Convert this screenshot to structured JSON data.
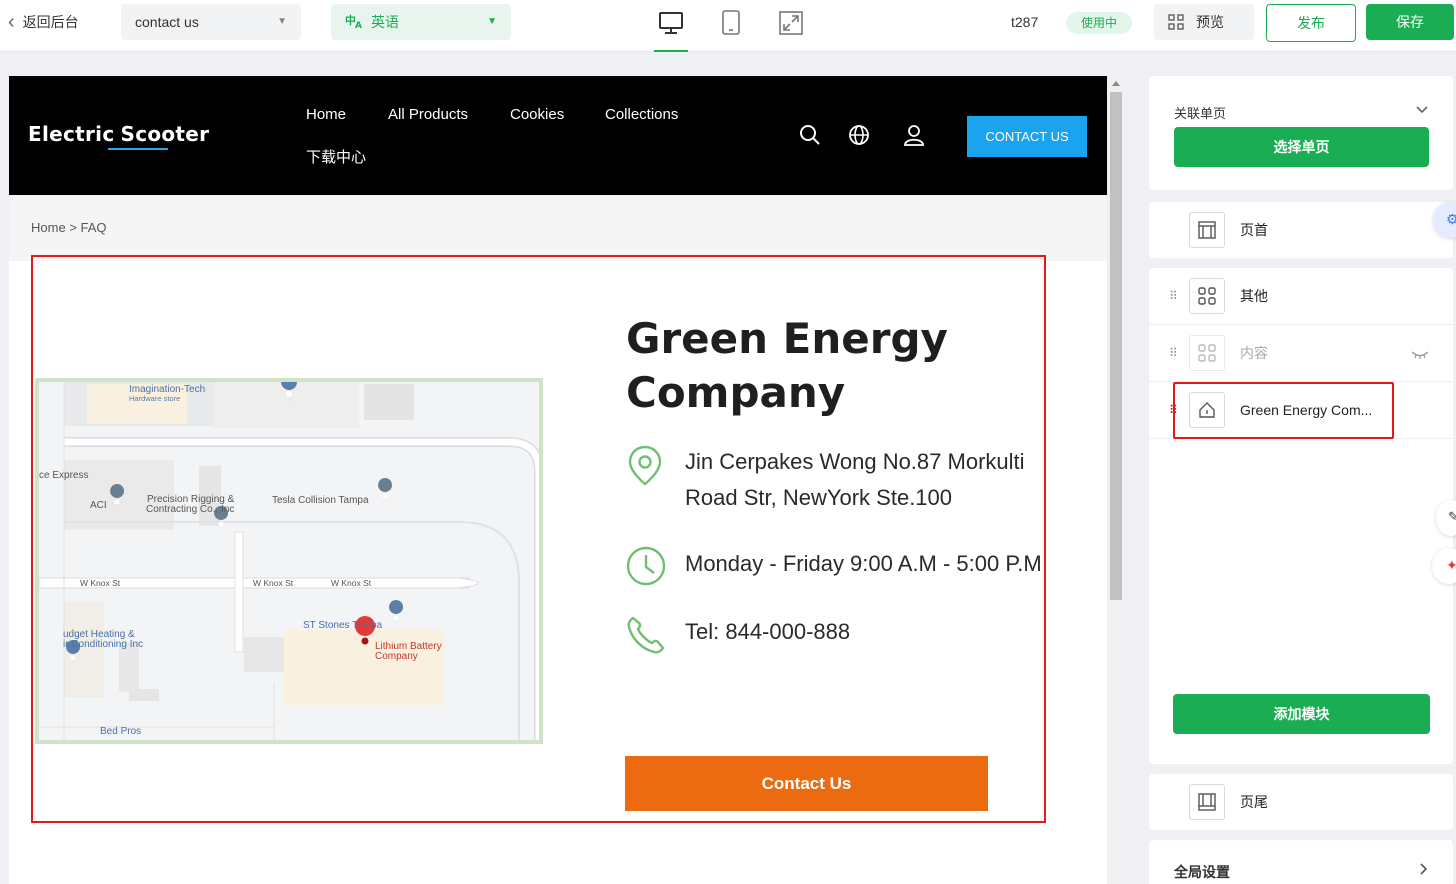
{
  "toolbar": {
    "back_label": "返回后台",
    "page_select": "contact us",
    "lang_select": "英语",
    "theme_id": "t287",
    "status_badge": "使用中",
    "preview_label": "预览",
    "publish_label": "发布",
    "save_label": "保存",
    "active_device": "desktop"
  },
  "site": {
    "logo_part1": "Electric",
    "logo_part2": "Scooter",
    "nav": [
      "Home",
      "All Products",
      "Cookies",
      "Collections",
      "下载中心"
    ],
    "header_button": "CONTACT US",
    "breadcrumb_home": "Home",
    "breadcrumb_sep": ">",
    "breadcrumb_current": "FAQ"
  },
  "content": {
    "title": "Green Energy Company",
    "address_line1": "Jin Cerpakes Wong No.87 Morkulti",
    "address_line2": "Road Str, NewYork Ste.100",
    "hours": "Monday - Friday 9:00 A.M - 5:00 P.M",
    "phone": "Tel: 844-000-888",
    "button": "Contact Us"
  },
  "map": {
    "labels": [
      "Imagination-Tech",
      "Hardware store",
      "ce Express",
      "ACI",
      "Precision Rigging &",
      "Contracting Co., Inc",
      "Tesla Collision Tampa",
      "W Knox St",
      "W Knox St",
      "W Knox St",
      "ST Stones Tampa",
      "udget Heating &",
      "ir Conditioning Inc",
      "Lithium Battery",
      "Company",
      "Bed Pros"
    ]
  },
  "panel": {
    "related_label": "关联单页",
    "select_page_button": "选择单页",
    "header_module": "页首",
    "other_module": "其他",
    "content_module": "内容",
    "green_module": "Green Energy Com...",
    "add_module_button": "添加模块",
    "footer_module": "页尾",
    "global_settings": "全局设置"
  },
  "colors": {
    "brand_green": "#1aad54",
    "header_blue": "#1aa3ee",
    "cta_orange": "#ec6b10",
    "selection_red": "#e21a1a",
    "icon_green": "#6fbf73"
  }
}
